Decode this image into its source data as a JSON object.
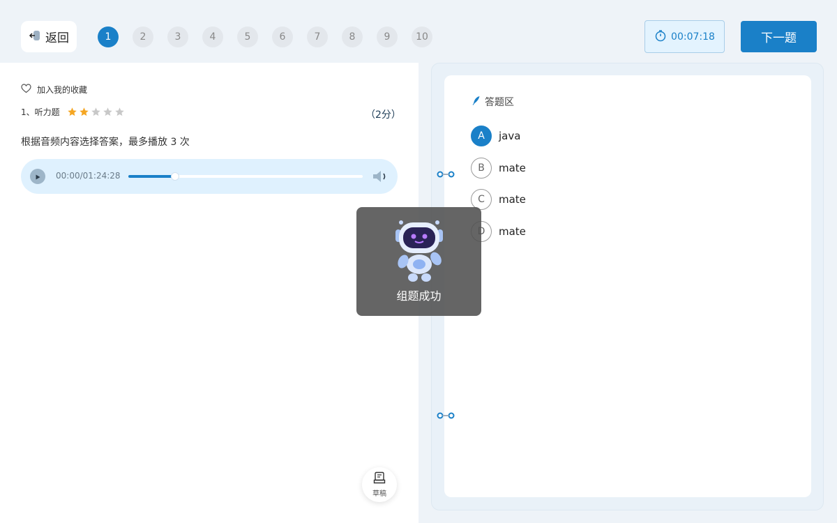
{
  "header": {
    "back_label": "返回",
    "questions": [
      "1",
      "2",
      "3",
      "4",
      "5",
      "6",
      "7",
      "8",
      "9",
      "10"
    ],
    "active_question": 1,
    "timer": "00:07:18",
    "next_label": "下一题"
  },
  "question": {
    "favorite_label": "加入我的收藏",
    "type_label": "1、听力题",
    "difficulty": 2,
    "difficulty_max": 5,
    "score": "（2分）",
    "text": "根据音频内容选择答案，最多播放 3 次",
    "audio": {
      "time": "00:00/01:24:28",
      "progress": 0.2
    }
  },
  "draft": {
    "label": "草稿"
  },
  "answer": {
    "title": "答题区",
    "options": [
      {
        "letter": "A",
        "text": "java",
        "selected": true
      },
      {
        "letter": "B",
        "text": "mate",
        "selected": false
      },
      {
        "letter": "C",
        "text": "mate",
        "selected": false
      },
      {
        "letter": "D",
        "text": "mate",
        "selected": false
      }
    ]
  },
  "toast": {
    "text": "组题成功"
  },
  "colors": {
    "primary": "#1a80c8",
    "star_on": "#f5a623",
    "star_off": "#c8c8c8"
  }
}
